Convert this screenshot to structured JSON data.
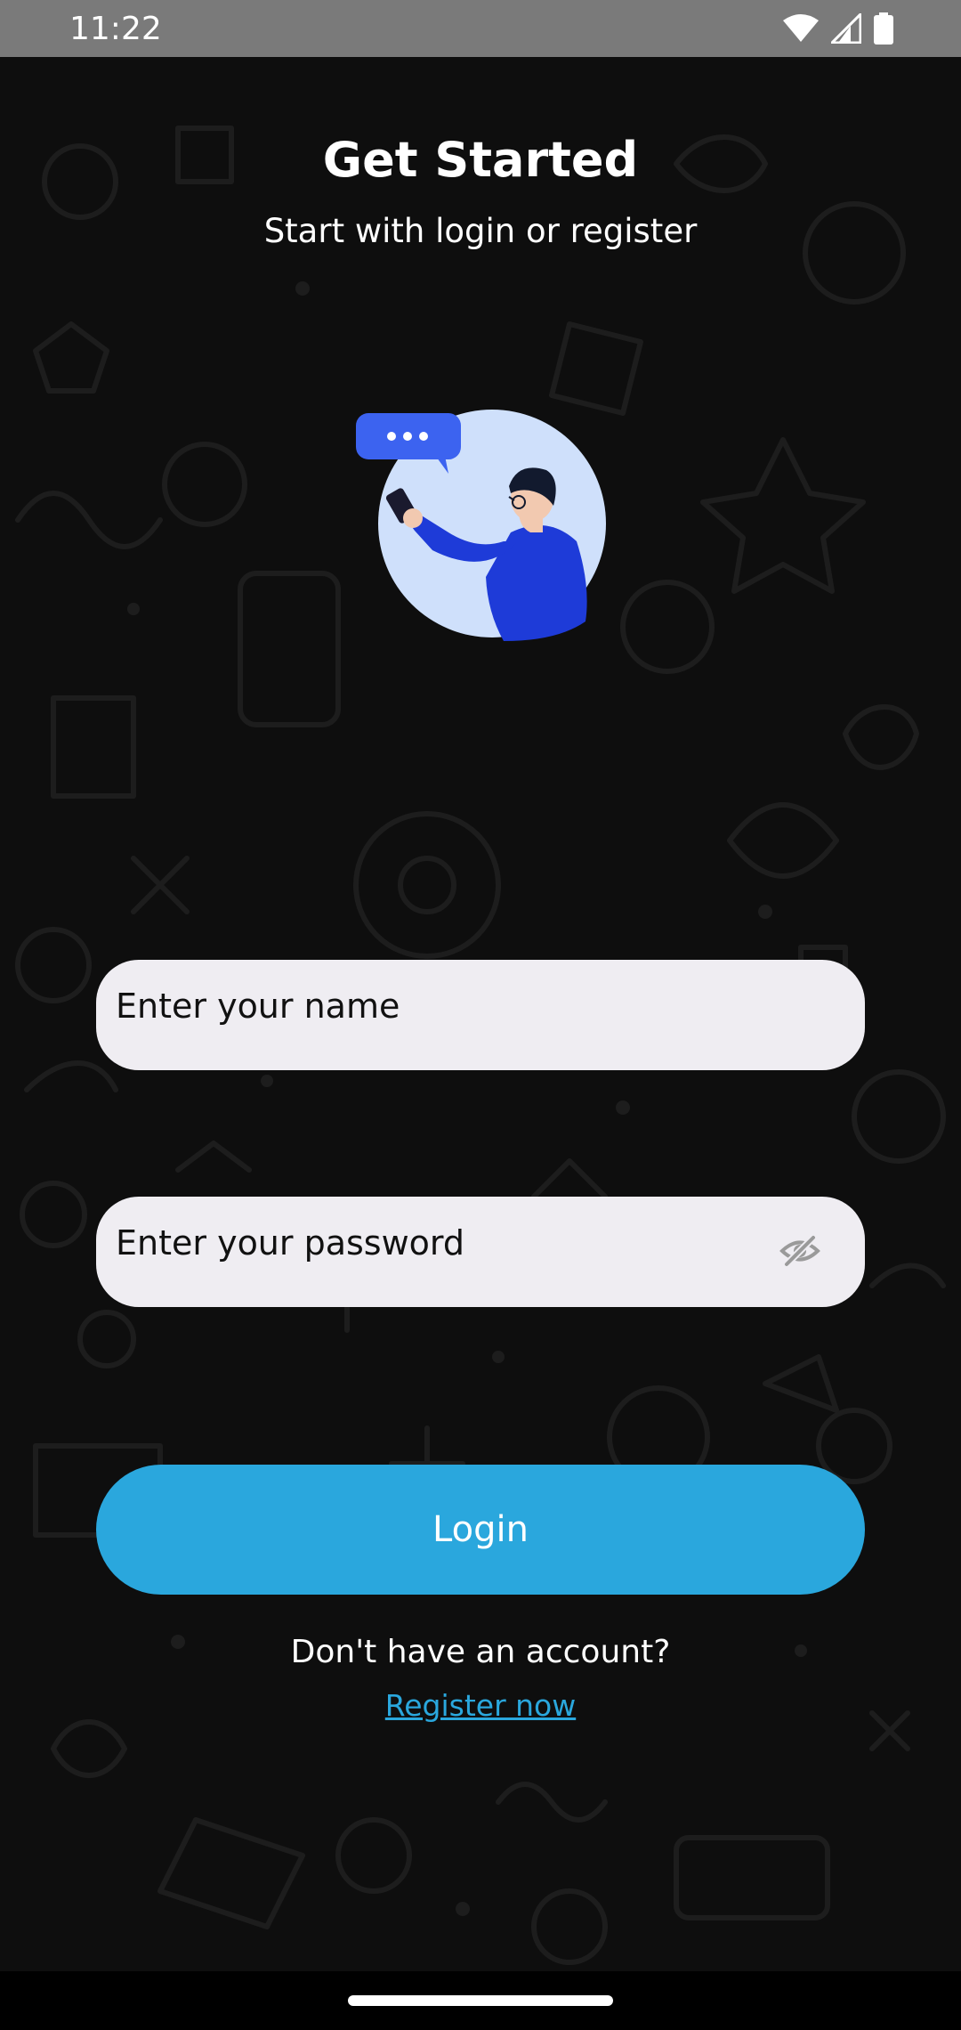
{
  "status_bar": {
    "time": "11:22",
    "icons": [
      "wifi-icon",
      "cellular-signal-icon",
      "battery-icon"
    ]
  },
  "header": {
    "title": "Get Started",
    "subtitle": "Start with login or register"
  },
  "illustration": {
    "name": "person-with-phone-chat-illustration",
    "chat_bubble_text": "•••"
  },
  "form": {
    "name_field": {
      "placeholder": "Enter your name",
      "value": ""
    },
    "password_field": {
      "placeholder": "Enter your password",
      "value": "",
      "toggle_icon": "eye-off-icon"
    },
    "login_label": "Login",
    "no_account_text": "Don't have an account?",
    "register_label": "Register now"
  },
  "colors": {
    "background": "#0e0e0e",
    "status_bar": "#7a7a7a",
    "input_background": "#efedf2",
    "accent": "#2aa7dd",
    "text_primary": "#ffffff",
    "illustration_blue": "#1e3bd8",
    "illustration_circle": "#cfe0fb"
  }
}
